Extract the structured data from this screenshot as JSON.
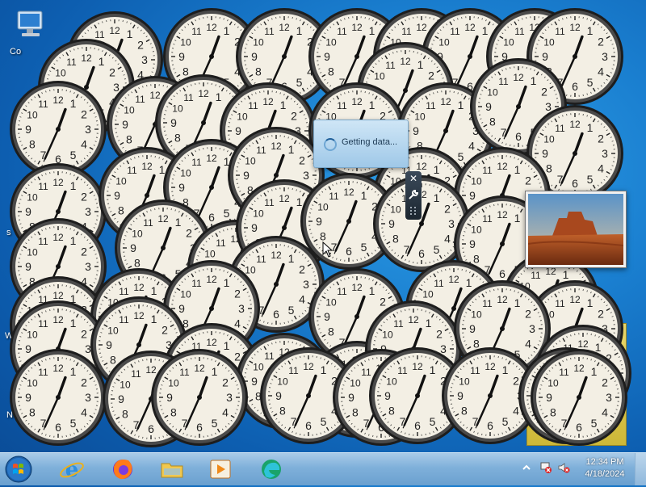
{
  "desktop": {
    "icon_computer_label": "Co",
    "hints": [
      "s",
      "W",
      "N"
    ]
  },
  "clock_widget": {
    "numbers": [
      "12",
      "1",
      "2",
      "3",
      "4",
      "5",
      "6",
      "7",
      "8",
      "9",
      "10",
      "11"
    ],
    "count": 56
  },
  "getting_data": {
    "text": "Getting data..."
  },
  "gadget_toolbar": {
    "close_icon": "close-icon",
    "options_icon": "wrench-icon",
    "drag_icon": "grip-icon"
  },
  "photo_gadget": {
    "subject": "desert-mesa"
  },
  "taskbar": {
    "pinned": [
      {
        "name": "internet-explorer-icon"
      },
      {
        "name": "firefox-icon"
      },
      {
        "name": "file-explorer-icon"
      },
      {
        "name": "media-player-icon"
      },
      {
        "name": "edge-icon"
      }
    ],
    "tray": {
      "time": "12:34 PM",
      "date": "4/18/2024"
    }
  },
  "colors": {
    "desktop_blue": "#1a7fd0",
    "taskbar": "#7fb0da",
    "clock_face": "#f3efe4",
    "clock_rim": "#2e2e2e"
  }
}
